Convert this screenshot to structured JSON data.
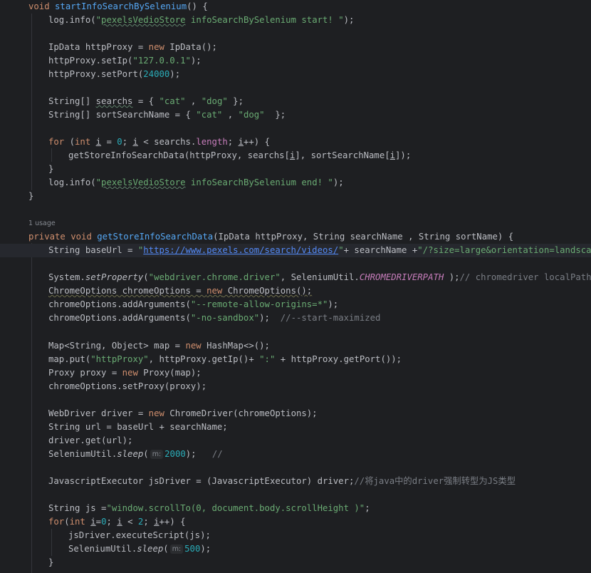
{
  "editor": {
    "theme_colors": {
      "background": "#1e1f22",
      "keyword": "#cf8e6d",
      "function": "#56a8f5",
      "string": "#6aab73",
      "number": "#2aacb8",
      "comment": "#7a7e85",
      "constant": "#c77dbb",
      "text": "#bcbec4"
    },
    "usage_hint": "1 usage",
    "param_hints": {
      "sleep_1": "m:",
      "sleep_2": "m:"
    },
    "code": {
      "l1": [
        "void",
        " ",
        "startInfoSearchBySelenium",
        "() {"
      ],
      "l2": [
        "log.info(",
        "\"",
        "pexelsVedioStore",
        " infoSearchBySelenium start! \"",
        ");"
      ],
      "l4": [
        "IpData httpProxy = ",
        "new",
        " IpData();"
      ],
      "l5": [
        "httpProxy.setIp(",
        "\"127.0.0.1\"",
        ");"
      ],
      "l6": [
        "httpProxy.setPort(",
        "24000",
        ");"
      ],
      "l8": [
        "String[] ",
        "searchs",
        " = { ",
        "\"cat\"",
        " , ",
        "\"dog\"",
        " };"
      ],
      "l9": [
        "String[] sortSearchName = { ",
        "\"cat\"",
        " , ",
        "\"dog\"",
        "  };"
      ],
      "l11": [
        "for",
        " (",
        "int",
        " ",
        "i",
        " = ",
        "0",
        "; ",
        "i",
        " < searchs.",
        "length",
        "; ",
        "i",
        "++) {"
      ],
      "l12": [
        "getStoreInfoSearchData(httpProxy, searchs[",
        "i",
        "], sortSearchName[",
        "i",
        "]);"
      ],
      "l13": [
        "}"
      ],
      "l14": [
        "log.info(",
        "\"",
        "pexelsVedioStore",
        " infoSearchBySelenium end! \"",
        ");"
      ],
      "l15": [
        "}"
      ],
      "l17": [
        "private",
        " ",
        "void",
        " ",
        "getStoreInfoSearchData",
        "(IpData httpProxy, String searchName , String sortName) {"
      ],
      "l18": [
        "String baseUrl = ",
        "\"",
        "https://www.pexels.com/search/videos/",
        "\"",
        "+ searchName +",
        "\"/?size=large&orientation=landscape\"",
        ";"
      ],
      "l20": [
        "System.",
        "setProperty",
        "(",
        "\"webdriver.chrome.driver\"",
        ", SeleniumUtil.",
        "CHROMEDRIVERPATH",
        " );",
        "// chromedriver localPath"
      ],
      "l21": [
        "ChromeOptions chromeOptions = ",
        "new",
        " ChromeOptions();"
      ],
      "l22": [
        "chromeOptions.addArguments(",
        "\"--remote-allow-origins=*\"",
        ");"
      ],
      "l23": [
        "chromeOptions.addArguments(",
        "\"-no-sandbox\"",
        ");  ",
        "//--start-maximized"
      ],
      "l25": [
        "Map<String, Object> map = ",
        "new",
        " HashMap<>();"
      ],
      "l26": [
        "map.put(",
        "\"httpProxy\"",
        ", httpProxy.getIp()+ ",
        "\":\"",
        " + httpProxy.getPort());"
      ],
      "l27": [
        "Proxy proxy = ",
        "new",
        " Proxy(map);"
      ],
      "l28": [
        "chromeOptions.setProxy(proxy);"
      ],
      "l30": [
        "WebDriver driver = ",
        "new",
        " ChromeDriver(chromeOptions);"
      ],
      "l31": [
        "String url = baseUrl + searchName;"
      ],
      "l32": [
        "driver.get(url);"
      ],
      "l33": [
        "SeleniumUtil.",
        "sleep",
        "(",
        "2000",
        ");   ",
        "//"
      ],
      "l35": [
        "JavascriptExecutor jsDriver = (JavascriptExecutor) driver;",
        "//将java中的driver强制转型为JS类型"
      ],
      "l37": [
        "String js =",
        "\"window.scrollTo(0, document.body.scrollHeight )\"",
        ";"
      ],
      "l38": [
        "for",
        "(",
        "int",
        " ",
        "i",
        "=",
        "0",
        "; ",
        "i",
        " < ",
        "2",
        "; ",
        "i",
        "++) {"
      ],
      "l39": [
        "jsDriver.executeScript(js);"
      ],
      "l40": [
        "SeleniumUtil.",
        "sleep",
        "(",
        "500",
        ");"
      ],
      "l41": [
        "}"
      ]
    }
  }
}
